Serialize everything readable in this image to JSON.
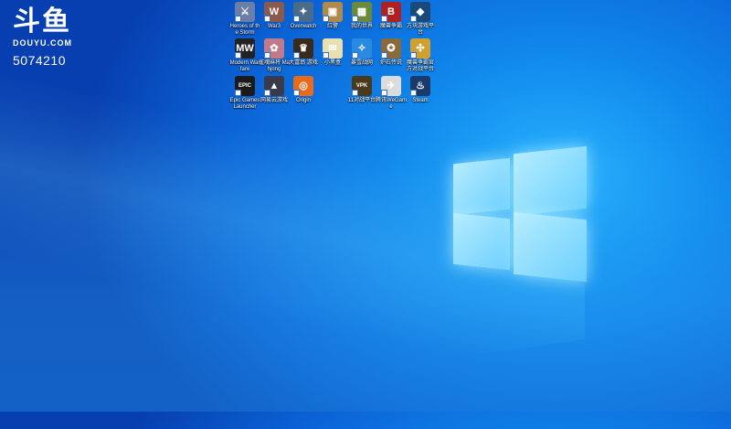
{
  "watermark": {
    "logo": "斗鱼",
    "domain": "DOUYU.COM",
    "room": "5074210"
  },
  "desktop": {
    "icons": [
      {
        "label": "Heroes of the Storm",
        "color": "#6a7fa8",
        "glyph": "⚔"
      },
      {
        "label": "War3",
        "color": "#8c5a4a",
        "glyph": "W"
      },
      {
        "label": "Overwatch",
        "color": "#4a6b8a",
        "glyph": "✦"
      },
      {
        "label": "红警",
        "color": "#b08a4a",
        "glyph": "▣"
      },
      {
        "label": "我的世界",
        "color": "#6a8a3a",
        "glyph": "▦"
      },
      {
        "label": "魔兽争霸",
        "color": "#b02020",
        "glyph": "B"
      },
      {
        "label": "方块游戏平台",
        "color": "#1a4a7a",
        "glyph": "◆"
      },
      {
        "label": "Modern Warfare",
        "color": "#222222",
        "glyph": "MW"
      },
      {
        "label": "雀魂麻将 Mahjong",
        "color": "#c07a8a",
        "glyph": "✿"
      },
      {
        "label": "大富翁 游戏",
        "color": "#3a2a1a",
        "glyph": "♛"
      },
      {
        "label": "小黑盒",
        "color": "#e8e0b0",
        "glyph": "✉"
      },
      {
        "label": "暴雪战网",
        "color": "#2a8ae0",
        "glyph": "✧"
      },
      {
        "label": "炉石传说",
        "color": "#8a6a3a",
        "glyph": "✪"
      },
      {
        "label": "魔兽争霸官方对战平台",
        "color": "#d0a030",
        "glyph": "✣"
      },
      {
        "label": "Epic Games Launcher",
        "color": "#1a1a1a",
        "glyph": "EPIC"
      },
      {
        "label": "网易云游戏",
        "color": "#3a3a4a",
        "glyph": "▲"
      },
      {
        "label": "Origin",
        "color": "#e86a1a",
        "glyph": "◎"
      },
      {
        "label": "11对战平台",
        "color": "#4a3a1a",
        "glyph": "VPK"
      },
      {
        "label": "腾讯WeGame",
        "color": "#dcdcdc",
        "glyph": "✈"
      },
      {
        "label": "Steam",
        "color": "#1a3a6a",
        "glyph": "♨"
      }
    ]
  }
}
